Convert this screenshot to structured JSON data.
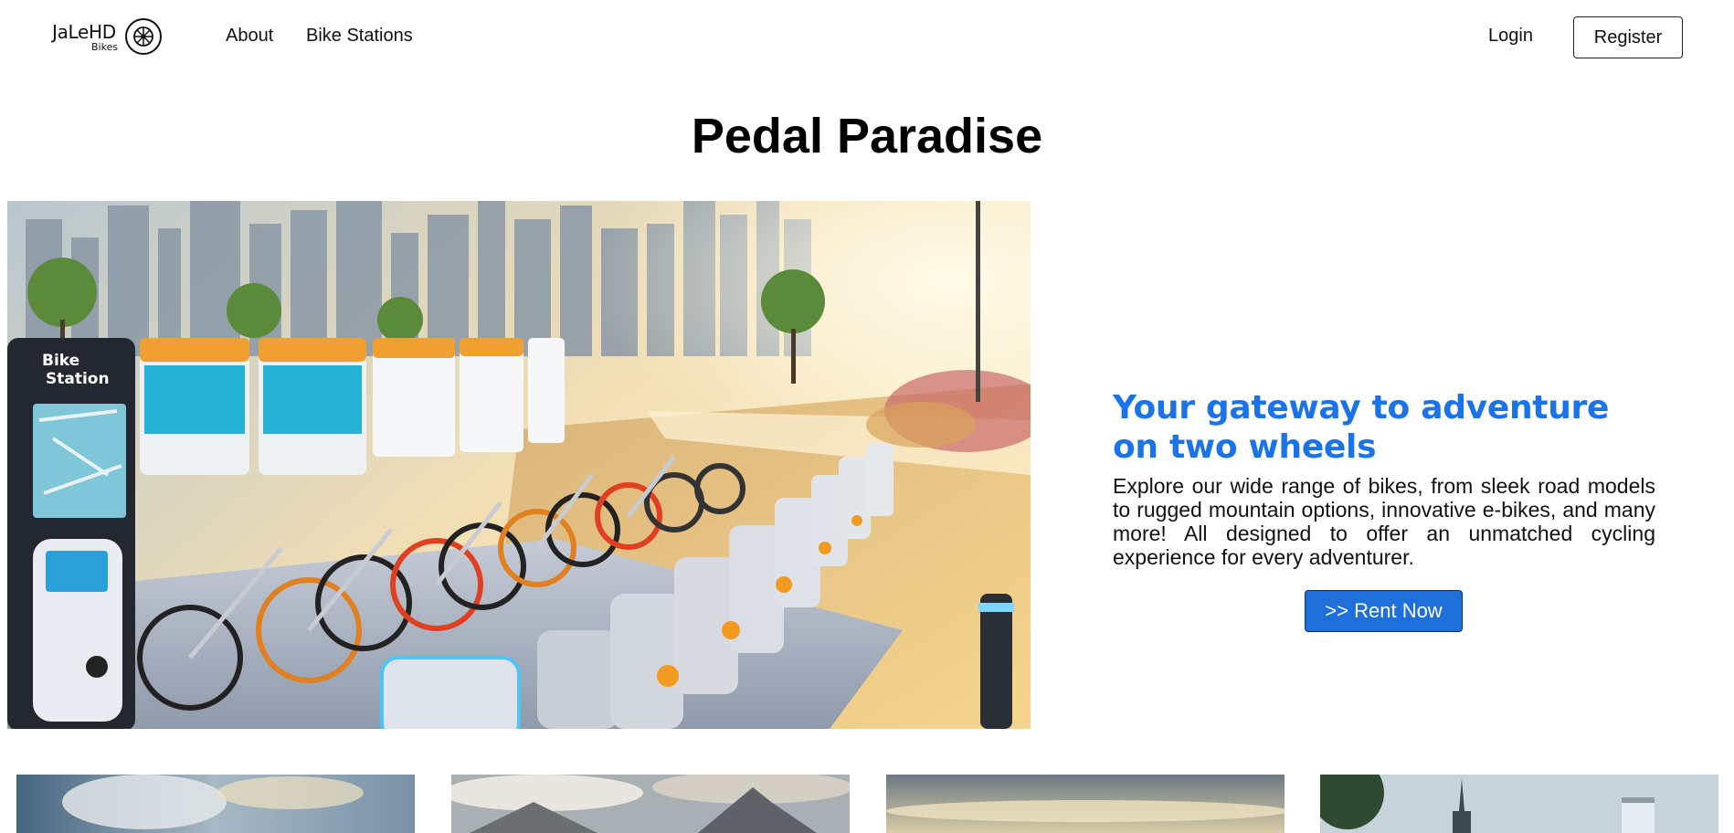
{
  "nav": {
    "logo_text": "JaLeHD",
    "logo_sub": "Bikes",
    "links": [
      {
        "label": "About"
      },
      {
        "label": "Bike Stations"
      }
    ],
    "login_label": "Login",
    "register_label": "Register"
  },
  "page_title": "Pedal Paradise",
  "hero": {
    "image_icon": "bike-station-illustration",
    "sign_line1": "Bike",
    "sign_line2": "Station",
    "heading": "Your gateway to adventure on two wheels",
    "body": "Explore our wide range of bikes, from sleek road models to rugged mountain options, innovative e-bikes, and many more! All designed to offer an unmatched cycling experience for every adventurer.",
    "cta_label": ">> Rent Now"
  },
  "colors": {
    "accent": "#1a73e8",
    "button": "#1e6fd9"
  },
  "cards": [
    {
      "icon": "sky-landscape-image"
    },
    {
      "icon": "mountain-landscape-image"
    },
    {
      "icon": "horizon-landscape-image"
    },
    {
      "icon": "city-landscape-image"
    }
  ]
}
